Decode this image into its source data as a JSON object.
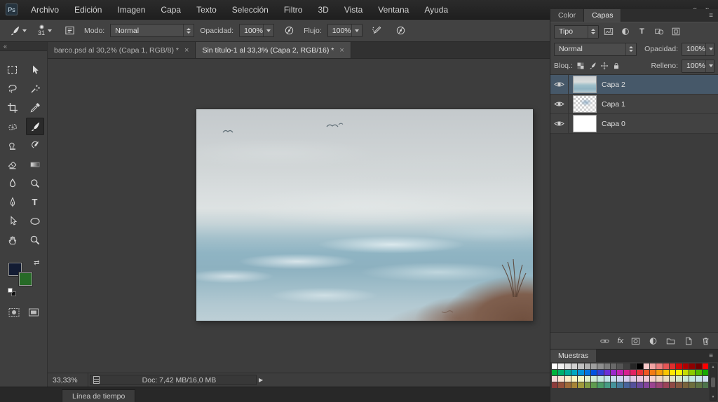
{
  "app_icon_label": "Ps",
  "icons": {
    "collapse": "«",
    "expand": "»",
    "swap": "⇄",
    "play": "▶",
    "scroll_up": "▲",
    "scroll_down": "▼",
    "panel_menu": "≡",
    "type_glyph": "T"
  },
  "menu_bar": {
    "items": [
      "Archivo",
      "Edición",
      "Imagen",
      "Capa",
      "Texto",
      "Selección",
      "Filtro",
      "3D",
      "Vista",
      "Ventana",
      "Ayuda"
    ]
  },
  "options_bar": {
    "brush_size": "31",
    "mode_label": "Modo:",
    "mode_value": "Normal",
    "opacity_label": "Opacidad:",
    "opacity_value": "100%",
    "flow_label": "Flujo:",
    "flow_value": "100%"
  },
  "document_tabs": [
    {
      "title": "barco.psd al 30,2% (Capa 1, RGB/8) *",
      "close_label": "×",
      "active": false
    },
    {
      "title": "Sin título-1 al 33,3% (Capa 2, RGB/16) *",
      "close_label": "×",
      "active": true
    }
  ],
  "tools": [
    "rectangular-marquee",
    "move",
    "lasso",
    "magic-wand",
    "crop",
    "eyedropper",
    "spot-healing",
    "brush",
    "clone-stamp",
    "history-brush",
    "eraser",
    "gradient",
    "blur",
    "dodge",
    "pen",
    "type",
    "path-selection",
    "ellipse-shape",
    "hand",
    "zoom"
  ],
  "active_tool": "brush",
  "tool_colors": {
    "foreground": "#131c33",
    "background": "#276a27"
  },
  "right_panel": {
    "panel_tabs": [
      {
        "label": "Color",
        "active": false
      },
      {
        "label": "Capas",
        "active": true
      }
    ],
    "filter_kind_label": "Tipo",
    "blend_mode": "Normal",
    "opacity_label": "Opacidad:",
    "opacity_value": "100%",
    "lock_label": "Bloq.:",
    "fill_label": "Relleno:",
    "fill_value": "100%",
    "layers": [
      {
        "name": "Capa 2",
        "selected": true,
        "thumb": "sea"
      },
      {
        "name": "Capa 1",
        "selected": false,
        "thumb": "checker"
      },
      {
        "name": "Capa 0",
        "selected": false,
        "thumb": "white"
      }
    ],
    "fx_label": "fx"
  },
  "swatches_panel": {
    "title": "Muestras",
    "rows": [
      [
        "#ffffff",
        "#f0f0f0",
        "#e0e0e0",
        "#d0d0d0",
        "#c0c0c0",
        "#b0b0b0",
        "#9f9f9f",
        "#8e8e8e",
        "#7c7c7c",
        "#696969",
        "#555555",
        "#3f3f3f",
        "#262626",
        "#000000",
        "#f7c7c7",
        "#f2a3a3",
        "#ec7d7d",
        "#e65656",
        "#e02f2f",
        "#d10808",
        "#b00000",
        "#8f0000",
        "#6e0000",
        "#ff0000"
      ],
      [
        "#00b33c",
        "#00b06e",
        "#00ad99",
        "#00a7c2",
        "#0092da",
        "#0074e0",
        "#0052e0",
        "#3340d8",
        "#6b2fd6",
        "#9a28cc",
        "#c222b4",
        "#d81f8e",
        "#e32063",
        "#ea3338",
        "#ef5722",
        "#f37b15",
        "#f79e09",
        "#fac400",
        "#ffe800",
        "#f8f400",
        "#c6dd00",
        "#8bcb00",
        "#50ba00",
        "#16aa00"
      ],
      [
        "#f8dada",
        "#fae4d2",
        "#fceeca",
        "#fdf7c3",
        "#f1f6c7",
        "#e1f0ce",
        "#d1ebd5",
        "#c7e7df",
        "#c4e4e9",
        "#c8ddee",
        "#cfd5f0",
        "#d8ceee",
        "#e2cae8",
        "#eac8de",
        "#f1cad5",
        "#f5d0cd",
        "#f0d7c5",
        "#eaddc1",
        "#e1e3c3",
        "#d5e7ca",
        "#cae9d5",
        "#c3e9e1",
        "#c6e5eb",
        "#cedef0"
      ],
      [
        "#8c3b3b",
        "#95503a",
        "#9e6a38",
        "#a78436",
        "#a09a3c",
        "#7f9b43",
        "#5f9b4f",
        "#4a9b68",
        "#459b84",
        "#45939b",
        "#467b9b",
        "#48639b",
        "#54509b",
        "#6a489b",
        "#84459b",
        "#9b4390",
        "#9b4374",
        "#9b4358",
        "#8f4a45",
        "#84573f",
        "#79633c",
        "#6d6e3e",
        "#5d7243",
        "#4d744b"
      ]
    ]
  },
  "status_bar": {
    "zoom": "33,33%",
    "doc_info": "Doc: 7,42 MB/16,0 MB"
  },
  "timeline": {
    "tab_label": "Línea de tiempo"
  }
}
